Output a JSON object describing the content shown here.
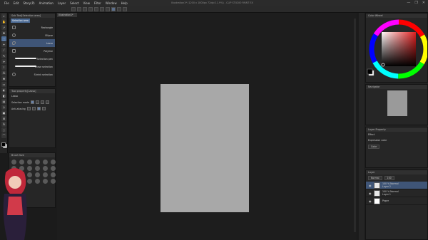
{
  "window": {
    "title": "Illustration1* (1200 x 1800px 72dpi 11.9%) - CLIP STUDIO PAINT EX",
    "menu": [
      "File",
      "Edit",
      "Story(P)",
      "Animation",
      "Layer",
      "Select",
      "View",
      "Filter",
      "Window",
      "Help"
    ],
    "controls": [
      "—",
      "❐",
      "✕"
    ]
  },
  "document_tab": {
    "label": "Illustration1*"
  },
  "subtool_panel": {
    "header": "Sub Tool[Selection area]",
    "tab": "Selection area",
    "items": [
      {
        "label": "Rectangle",
        "selected": false
      },
      {
        "label": "Ellipse",
        "selected": false
      },
      {
        "label": "Lasso",
        "selected": true
      },
      {
        "label": "Polyline",
        "selected": false
      },
      {
        "label": "Selection pen",
        "selected": false
      },
      {
        "label": "Erase selection",
        "selected": false
      },
      {
        "label": "Shrink selection",
        "selected": false
      }
    ]
  },
  "tool_property": {
    "header": "Tool property[Lasso]",
    "tool_name": "Lasso",
    "rows": [
      {
        "label": "Selection mode"
      },
      {
        "label": "Anti-aliasing"
      }
    ]
  },
  "brush_size": {
    "header": "Brush Size"
  },
  "navigator": {
    "header": "Navigator"
  },
  "layer_property": {
    "header": "Layer Property",
    "effect_label": "Effect",
    "expression_color_label": "Expression color",
    "expression_color_value": "Color"
  },
  "color_wheel": {
    "header": "Color Wheel",
    "hue_color": "#e02020"
  },
  "layers": {
    "header": "Layer",
    "blend_mode": "Normal",
    "opacity": "100",
    "rows": [
      {
        "meta": "100 % Normal",
        "name": "Layer 2",
        "selected": true
      },
      {
        "meta": "100 % Normal",
        "name": "Layer 1",
        "selected": false
      },
      {
        "meta": "",
        "name": "Paper",
        "selected": false
      }
    ]
  },
  "colors": {
    "accent": "#4d6c95",
    "paper": "#a8a8a8",
    "background": "#1b1b1b"
  }
}
